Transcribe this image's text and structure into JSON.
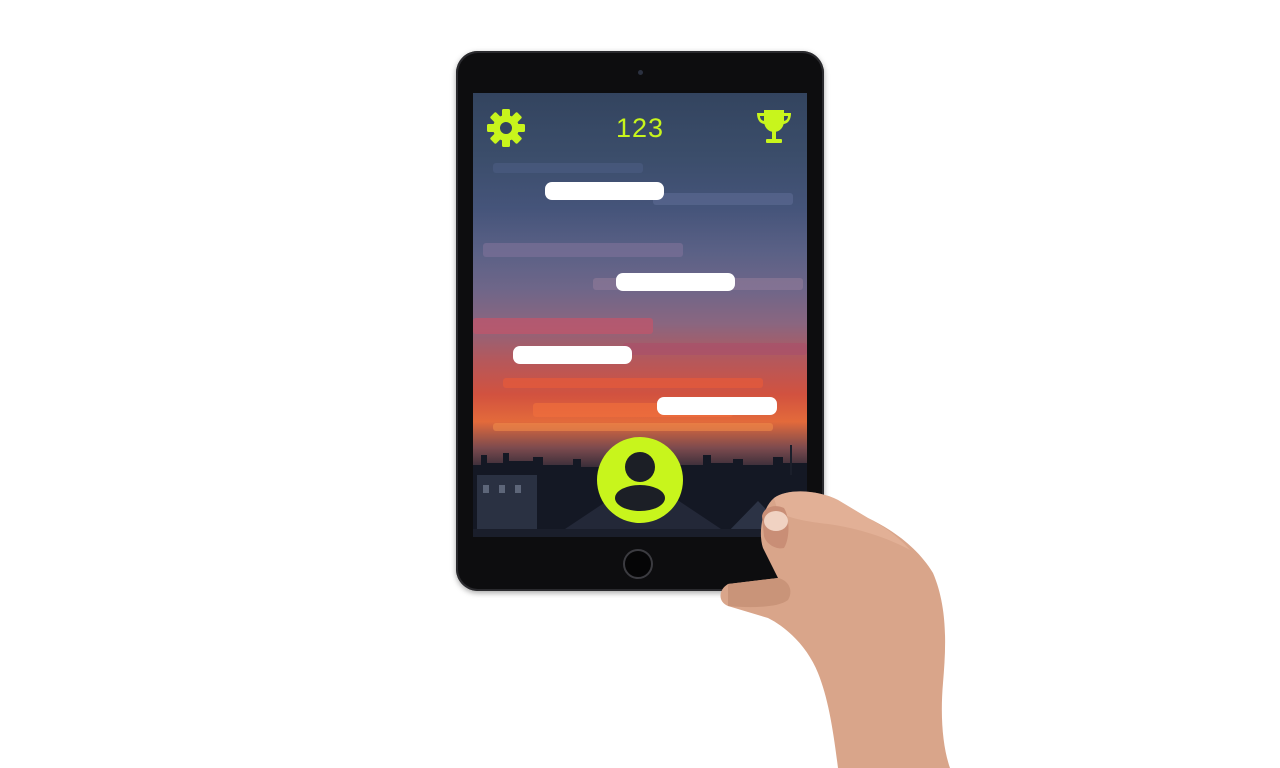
{
  "game": {
    "score": "123",
    "accent_color": "#c8f51c",
    "platform_color": "#ffffff"
  },
  "icons": {
    "settings": "gear-icon",
    "leaderboard": "trophy-icon",
    "player": "user-avatar-icon"
  }
}
